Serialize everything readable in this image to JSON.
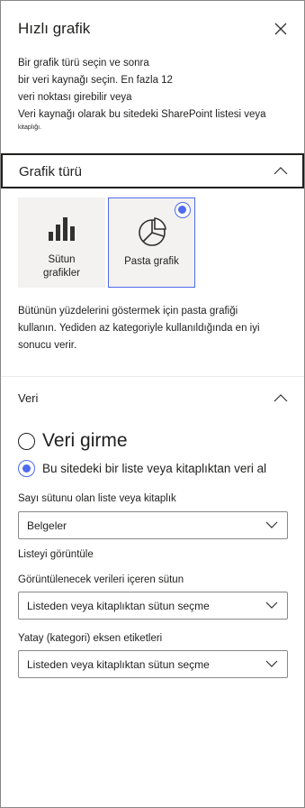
{
  "header": {
    "title": "Hızlı grafik"
  },
  "intro": {
    "lines": [
      "Bir grafik türü seçin ve sonra",
      "bir veri kaynağı seçin. En fazla 12",
      "veri noktası girebilir veya",
      "Veri kaynağı olarak bu sitedeki SharePoint listesi veya"
    ],
    "small": "kitaplığı."
  },
  "chart_type_section": {
    "label": "Grafik türü",
    "tiles": [
      {
        "label_line1": "Sütun",
        "label_line2": "grafikler",
        "selected": false,
        "icon": "column-chart-icon"
      },
      {
        "label": "Pasta grafik",
        "selected": true,
        "icon": "pie-chart-icon"
      }
    ],
    "description": "Bütünün yüzdelerini göstermek için pasta grafiği kullanın. Yediden az kategoriyle kullanıldığında en iyi sonucu verir."
  },
  "data_section": {
    "label": "Veri",
    "options": [
      {
        "label": "Veri girme",
        "selected": false
      },
      {
        "label": "Bu sitedeki bir liste veya kitaplıktan veri al",
        "selected": true
      }
    ],
    "list_field": {
      "label": "Sayı sütunu olan liste veya kitaplık",
      "value": "Belgeler"
    },
    "view_list_label": "Listeyi görüntüle",
    "data_column_field": {
      "label": "Görüntülenecek verileri içeren sütun",
      "value": "Listeden veya kitaplıktan sütun seçme"
    },
    "axis_field": {
      "label": "Yatay (kategori) eksen etiketleri",
      "value": "Listeden veya kitaplıktan sütun seçme"
    }
  },
  "colors": {
    "accent": "#4f6bed",
    "text": "#201f1e",
    "tile_bg": "#f3f2f1",
    "border": "#8a8886"
  }
}
